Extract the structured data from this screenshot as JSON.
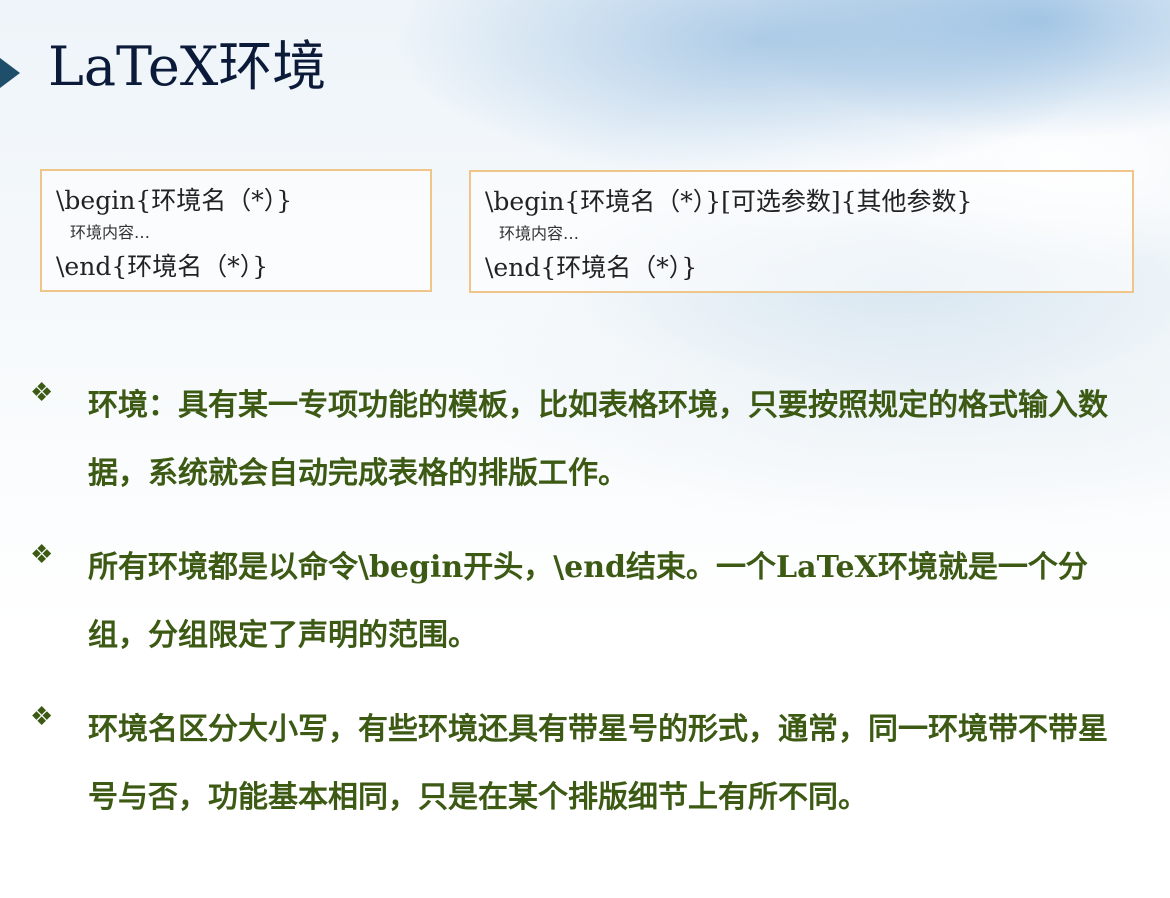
{
  "slide": {
    "title": "LaTeX环境"
  },
  "code_boxes": [
    {
      "line1": "\\begin{环境名（*）}",
      "content": "环境内容…",
      "line3": "\\end{环境名（*）}"
    },
    {
      "line1": "\\begin{环境名（*）}[可选参数]{其他参数}",
      "content": "环境内容…",
      "line3": "\\end{环境名（*）}"
    }
  ],
  "bullets": [
    {
      "icon": "diamond-bullet-icon",
      "text": "环境：具有某一专项功能的模板，比如表格环境，只要按照规定的格式输入数据，系统就会自动完成表格的排版工作。"
    },
    {
      "icon": "diamond-bullet-icon",
      "text": "所有环境都是以命令\\begin开头，\\end结束。一个LaTeX环境就是一个分组，分组限定了声明的范围。"
    },
    {
      "icon": "diamond-bullet-icon",
      "text": "环境名区分大小写，有些环境还具有带星号的形式，通常，同一环境带不带星号与否，功能基本相同，只是在某个排版细节上有所不同。"
    }
  ],
  "colors": {
    "title": "#0c1a3a",
    "bullet_text": "#3c5a14",
    "box_border": "#f0c58a",
    "marker": "#1f4e6b"
  }
}
